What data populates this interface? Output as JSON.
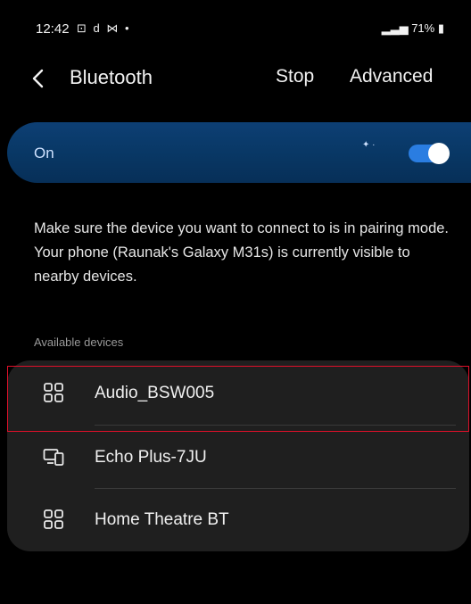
{
  "status_bar": {
    "time": "12:42",
    "left_icons": "⊡ d ⋈ •",
    "right_text": "71%"
  },
  "header": {
    "title": "Bluetooth",
    "stop_label": "Stop",
    "advanced_label": "Advanced"
  },
  "toggle": {
    "label": "On",
    "state": "on",
    "accent": "#2a7de1"
  },
  "description": "Make sure the device you want to connect to is in pairing mode. Your phone (Raunak's Galaxy M31s) is currently visible to nearby devices.",
  "available_devices": {
    "heading": "Available devices",
    "items": [
      {
        "label": "Audio_BSW005",
        "icon": "audio-device-icon"
      },
      {
        "label": "Echo Plus-7JU",
        "icon": "computer-device-icon"
      },
      {
        "label": "Home Theatre BT",
        "icon": "audio-device-icon"
      }
    ]
  },
  "colors": {
    "background": "#000000",
    "toggle_bar": "#083764",
    "card": "#1f1f1f",
    "highlight": "#e0102a"
  }
}
